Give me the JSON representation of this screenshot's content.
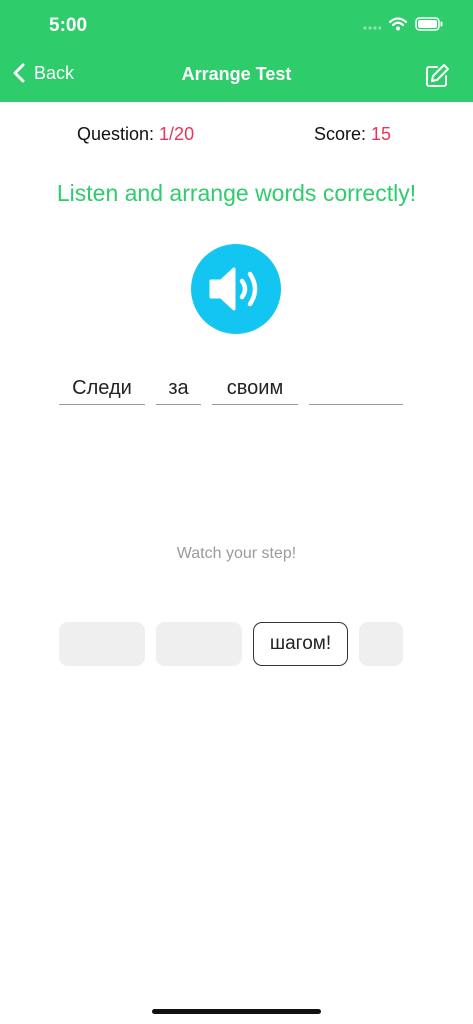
{
  "status": {
    "time": "5:00"
  },
  "nav": {
    "back_label": "Back",
    "title": "Arrange Test"
  },
  "progress": {
    "question_label": "Question: ",
    "question_value": "1/20",
    "score_label": "Score: ",
    "score_value": "15"
  },
  "instruction": "Listen and arrange words correctly!",
  "answer_slots": [
    "Следи",
    "за",
    "своим",
    ""
  ],
  "translation": "Watch your step!",
  "word_chips": [
    {
      "text": "",
      "used": true
    },
    {
      "text": "",
      "used": true
    },
    {
      "text": "шагом!",
      "used": false
    },
    {
      "text": "",
      "used": true
    }
  ],
  "colors": {
    "header": "#2ecc6a",
    "accent": "#e8345a",
    "speaker": "#12c6f1",
    "instruction": "#2ecc6a"
  },
  "icons": {
    "back": "chevron-left-icon",
    "edit": "edit-icon",
    "speaker": "speaker-icon",
    "wifi": "wifi-icon",
    "battery": "battery-icon",
    "signal": "signal-icon"
  }
}
